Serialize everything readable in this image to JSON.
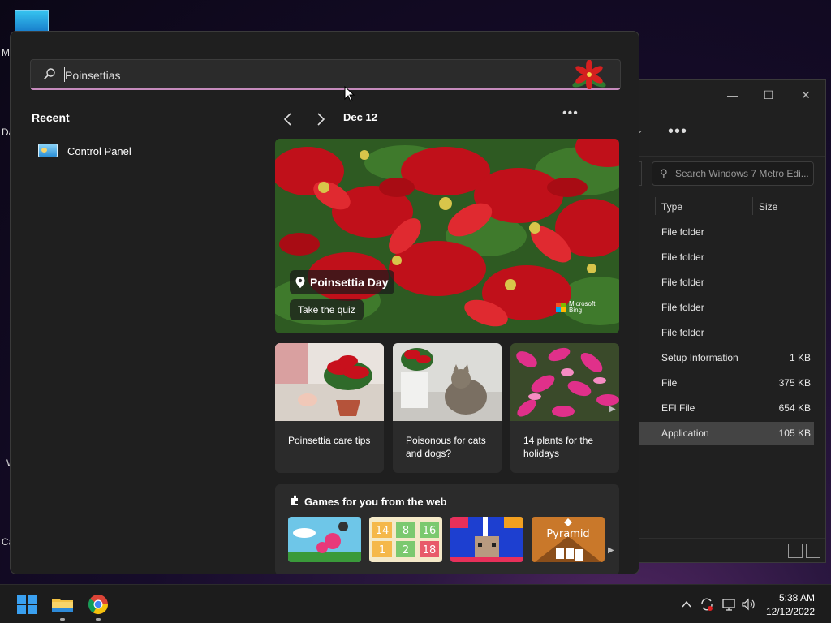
{
  "desktop": {
    "edge_letters": [
      "M",
      "Da",
      "W",
      "Ca"
    ]
  },
  "explorer": {
    "search_placeholder": "Search Windows 7 Metro Edi...",
    "columns": [
      "Type",
      "Size"
    ],
    "rows": [
      {
        "type": "File folder",
        "size": ""
      },
      {
        "type": "File folder",
        "size": ""
      },
      {
        "type": "File folder",
        "size": ""
      },
      {
        "type": "File folder",
        "size": ""
      },
      {
        "type": "File folder",
        "size": ""
      },
      {
        "type": "Setup Information",
        "size": "1 KB"
      },
      {
        "type": "File",
        "size": "375 KB"
      },
      {
        "type": "EFI File",
        "size": "654 KB"
      },
      {
        "type": "Application",
        "size": "105 KB"
      }
    ],
    "selected_row": 8,
    "more_label": "•••"
  },
  "search": {
    "query": "Poinsettias"
  },
  "recent": {
    "title": "Recent",
    "items": [
      {
        "label": "Control Panel",
        "icon": "control-panel-icon"
      }
    ]
  },
  "highlights": {
    "date": "Dec 12",
    "more_label": "•••",
    "hero": {
      "title": "Poinsettia Day",
      "action": "Take the quiz",
      "brand": "Microsoft Bing"
    },
    "cards": [
      {
        "text": "Poinsettia care tips"
      },
      {
        "text": "Poisonous for cats and dogs?"
      },
      {
        "text": "14 plants for the holidays"
      }
    ],
    "games": {
      "title": "Games for you from the web",
      "tiles": [
        "",
        "14 8 16 1 2 18",
        "",
        "Pyramid"
      ]
    }
  },
  "taskbar": {
    "time": "5:38 AM",
    "date": "12/12/2022"
  },
  "colors": {
    "accent_underline": "#c68bbd",
    "flyout_bg": "#1f1f1f",
    "card_bg": "#2b2b2b"
  }
}
